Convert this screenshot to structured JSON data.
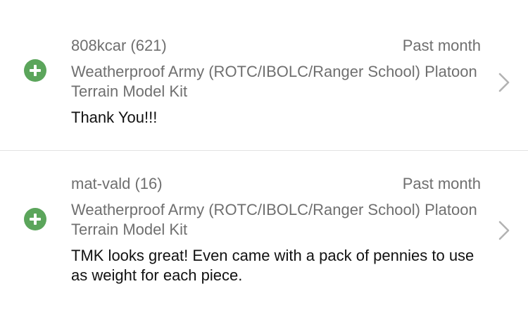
{
  "feedback": [
    {
      "username": "808kcar (621)",
      "date": "Past month",
      "item_title": "Weatherproof Army (ROTC/IBOLC/Ranger School) Platoon Terrain Model Kit",
      "comment": "Thank You!!!",
      "rating_icon": "positive-plus-icon",
      "rating_color": "#5ba55b"
    },
    {
      "username": "mat-vald (16)",
      "date": "Past month",
      "item_title": "Weatherproof Army (ROTC/IBOLC/Ranger School) Platoon Terrain Model Kit",
      "comment": "TMK looks great! Even came with a pack of pennies to use as weight for each piece.",
      "rating_icon": "positive-plus-icon",
      "rating_color": "#5ba55b"
    }
  ]
}
